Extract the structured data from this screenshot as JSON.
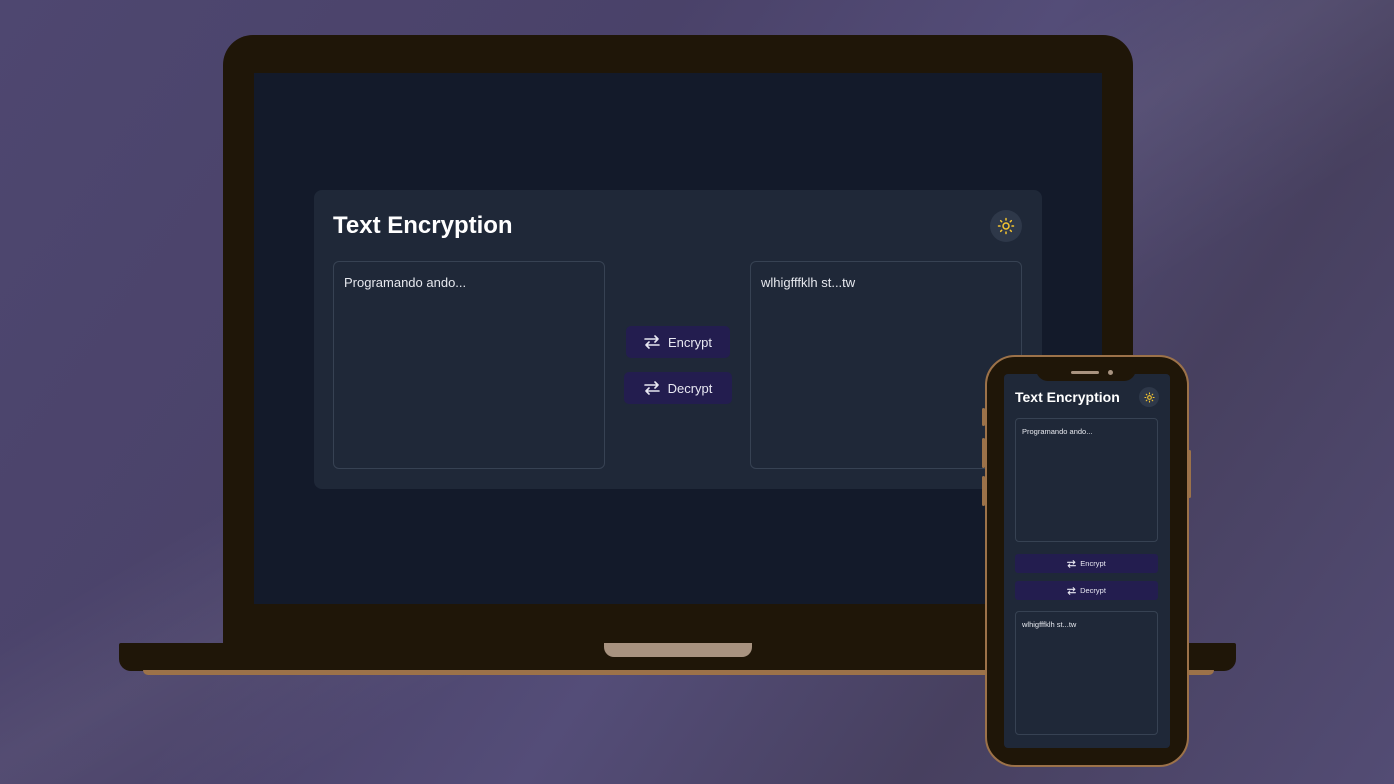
{
  "app": {
    "title": "Text Encryption",
    "input_text": "Programando ando...",
    "output_text": "wlhigfffklh st...tw",
    "encrypt_label": "Encrypt",
    "decrypt_label": "Decrypt",
    "theme_icon": "sun-icon",
    "swap_icon": "swap-arrows-icon"
  },
  "mobile": {
    "title": "Text Encryption",
    "input_text": "Programando ando...",
    "output_text": "wlhigfffklh st...tw",
    "encrypt_label": "Encrypt",
    "decrypt_label": "Decrypt"
  },
  "colors": {
    "background": "#4e4770",
    "device_frame": "#1f1608",
    "device_accent": "#9c7249",
    "screen_bg": "#131a2a",
    "card_bg": "#1f2838",
    "button_bg": "#231d4f",
    "sun_icon": "#f5c531"
  }
}
